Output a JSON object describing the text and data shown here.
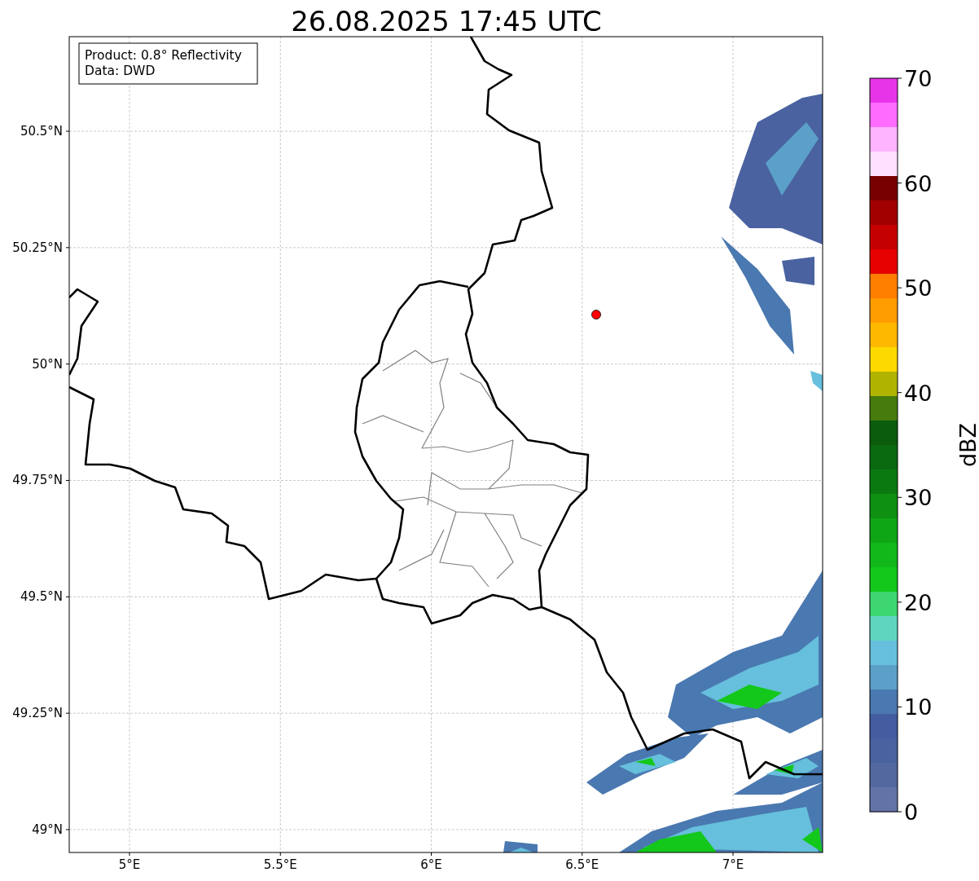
{
  "title": "26.08.2025 17:45 UTC",
  "legend": {
    "lines": [
      "Product: 0.8° Reflectivity",
      "Data: DWD"
    ]
  },
  "x_ticks": [
    "5°E",
    "5.5°E",
    "6°E",
    "6.5°E",
    "7°E"
  ],
  "y_ticks": [
    "50.5°N",
    "50.25°N",
    "50°N",
    "49.75°N",
    "49.5°N",
    "49.25°N",
    "49°N"
  ],
  "colorbar": {
    "label": "dBZ",
    "ticks": [
      "70",
      "60",
      "50",
      "40",
      "30",
      "20",
      "10",
      "0"
    ],
    "segments": [
      {
        "color": "#e834e8"
      },
      {
        "color": "#ff6cff"
      },
      {
        "color": "#ffb4ff"
      },
      {
        "color": "#ffe0ff"
      },
      {
        "color": "#780000"
      },
      {
        "color": "#a20000"
      },
      {
        "color": "#c40000"
      },
      {
        "color": "#e60000"
      },
      {
        "color": "#ff7e00"
      },
      {
        "color": "#ff9c00"
      },
      {
        "color": "#ffb800"
      },
      {
        "color": "#fdd900"
      },
      {
        "color": "#b0b400"
      },
      {
        "color": "#467b0d"
      },
      {
        "color": "#0b5c0c"
      },
      {
        "color": "#0a6a10"
      },
      {
        "color": "#0a7a10"
      },
      {
        "color": "#0e9012"
      },
      {
        "color": "#0fa616"
      },
      {
        "color": "#12b81a"
      },
      {
        "color": "#13c81b"
      },
      {
        "color": "#3dd670"
      },
      {
        "color": "#5fd5c0"
      },
      {
        "color": "#66bfdc"
      },
      {
        "color": "#5ba0c8"
      },
      {
        "color": "#4a78b0"
      },
      {
        "color": "#445ca0"
      },
      {
        "color": "#4a62a0"
      },
      {
        "color": "#5468a0"
      },
      {
        "color": "#6373a8"
      }
    ]
  }
}
